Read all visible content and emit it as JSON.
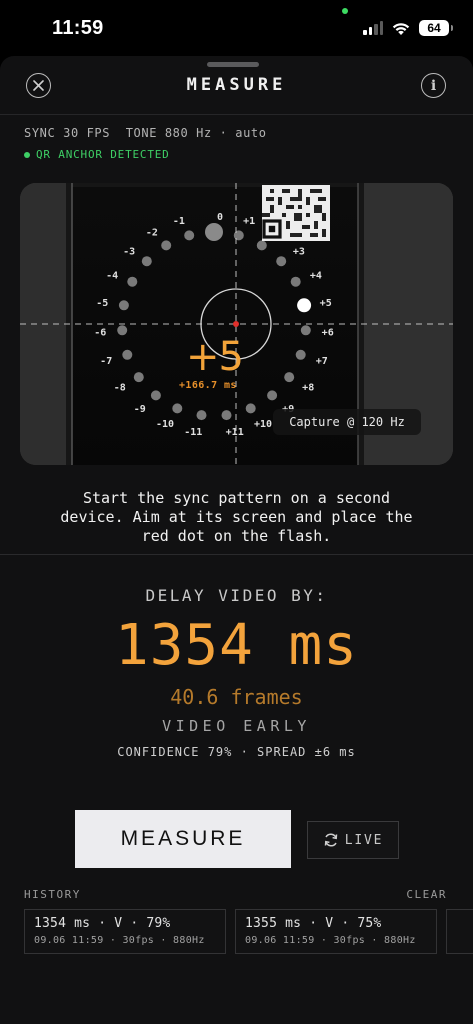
{
  "status_bar": {
    "time": "11:59",
    "battery": "64"
  },
  "header": {
    "title": "MEASURE"
  },
  "settings": {
    "line": "SYNC 30 FPS  TONE 880 Hz · auto",
    "anchor_status": "QR ANCHOR DETECTED"
  },
  "viewfinder": {
    "dial_labels": [
      "0",
      "+1",
      "+2",
      "+3",
      "+4",
      "+5",
      "+6",
      "+7",
      "+8",
      "+9",
      "+10",
      "+11",
      "-11",
      "-10",
      "-9",
      "-8",
      "-7",
      "-6",
      "-5",
      "-4",
      "-3",
      "-2",
      "-1"
    ],
    "current_offset": "+5",
    "offset_ms": "+166.7 ms",
    "capture_rate": "Capture @ 120 Hz"
  },
  "instructions": {
    "line1": "Start the sync pattern on a second",
    "line2": "device. Aim at its screen and place the",
    "line3": "red dot on the flash."
  },
  "result": {
    "label": "DELAY VIDEO BY:",
    "delay": "1354 ms",
    "frames": "40.6 frames",
    "direction": "VIDEO EARLY",
    "confidence": "CONFIDENCE 79% · SPREAD ±6 ms"
  },
  "actions": {
    "measure": "MEASURE",
    "live": "LIVE"
  },
  "history": {
    "label": "HISTORY",
    "clear": "CLEAR",
    "items": [
      {
        "main": "1354 ms · V · 79%",
        "sub": "09.06 11:59 · 30fps · 880Hz"
      },
      {
        "main": "1355 ms · V · 75%",
        "sub": "09.06 11:59 · 30fps · 880Hz"
      }
    ]
  },
  "colors": {
    "accent": "#f3a33c",
    "status_green": "#3ecf65",
    "reticle_red": "#e0302c"
  },
  "icons": [
    "signal-icon",
    "wifi-icon",
    "battery-icon",
    "close-icon",
    "info-icon",
    "refresh-icon"
  ]
}
